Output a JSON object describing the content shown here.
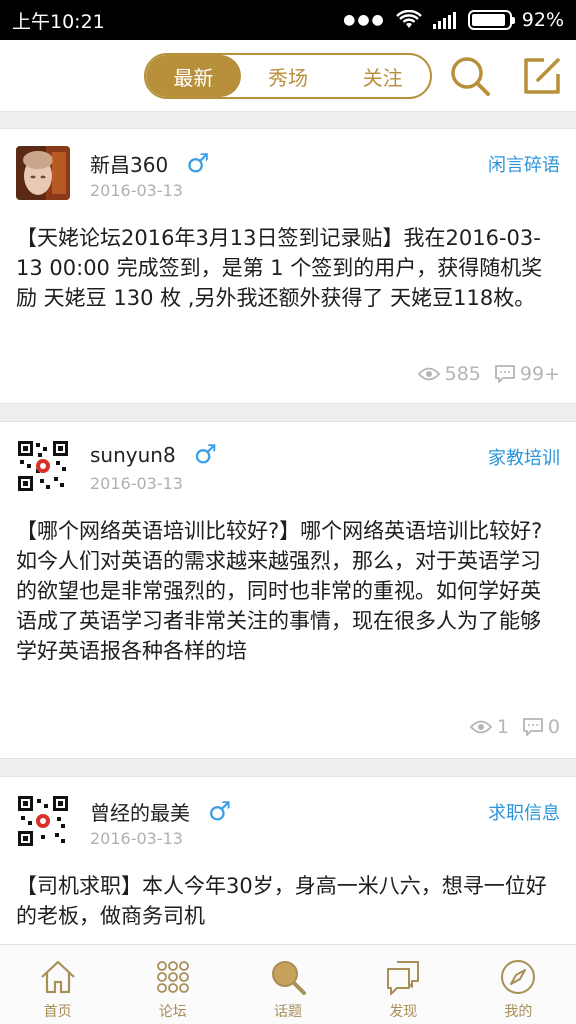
{
  "status_bar": {
    "time": "上午10:21",
    "battery": "92%",
    "battery_level": 0.92
  },
  "header": {
    "tabs": [
      {
        "label": "最新",
        "active": true
      },
      {
        "label": "秀场",
        "active": false
      },
      {
        "label": "关注",
        "active": false
      }
    ],
    "search_icon": "search-icon",
    "compose_icon": "compose-icon"
  },
  "posts": [
    {
      "author": "新昌360",
      "gender": "♂",
      "date": "2016-03-13",
      "category": "闲言碎语",
      "content": "【天姥论坛2016年3月13日签到记录贴】我在2016-03-13 00:00 完成签到，是第 1 个签到的用户，获得随机奖励 天姥豆 130 枚 ,另外我还额外获得了 天姥豆118枚。",
      "views": "585",
      "comments": "99+"
    },
    {
      "author": "sunyun8",
      "gender": "♂",
      "date": "2016-03-13",
      "category": "家教培训",
      "content": "【哪个网络英语培训比较好?】哪个网络英语培训比较好?　　如今人们对英语的需求越来越强烈，那么，对于英语学习的欲望也是非常强烈的，同时也非常的重视。如何学好英语成了英语学习者非常关注的事情，现在很多人为了能够学好英语报各种各样的培",
      "views": "1",
      "comments": "0"
    },
    {
      "author": "曾经的最美",
      "gender": "♂",
      "date": "2016-03-13",
      "category": "求职信息",
      "content": "【司机求职】本人今年30岁，身高一米八六，想寻一位好的老板，做商务司机"
    }
  ],
  "bottom_nav": [
    {
      "label": "首页",
      "icon": "home-icon"
    },
    {
      "label": "论坛",
      "icon": "grid-icon"
    },
    {
      "label": "话题",
      "icon": "topic-search-icon"
    },
    {
      "label": "发现",
      "icon": "discover-icon"
    },
    {
      "label": "我的",
      "icon": "compass-icon"
    }
  ],
  "colors": {
    "accent": "#b8903c",
    "link": "#2a95dc",
    "muted": "#b5b5b5"
  }
}
